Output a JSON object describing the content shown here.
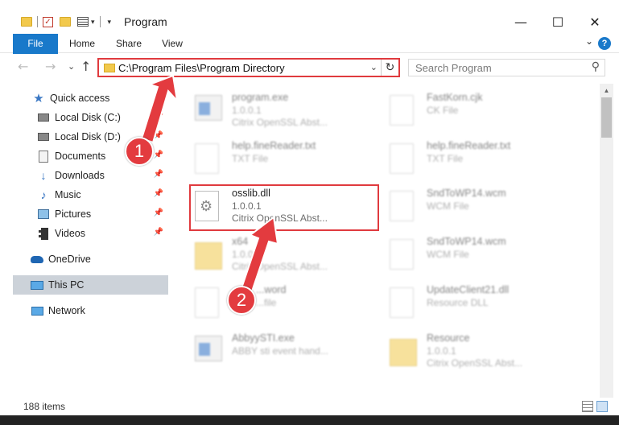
{
  "window": {
    "title": "Program",
    "minimize_icon": "minimize-icon",
    "maximize_icon": "maximize-icon",
    "close_icon": "close-icon"
  },
  "ribbon": {
    "tabs": [
      {
        "label": "File"
      },
      {
        "label": "Home"
      },
      {
        "label": "Share"
      },
      {
        "label": "View"
      }
    ],
    "help": "?",
    "expand": "⌄"
  },
  "nav": {
    "back": "←",
    "forward": "→",
    "recent": "⌄",
    "up": "↑",
    "address": "C:\\Program Files\\Program Directory",
    "search_placeholder": "Search Program"
  },
  "sidebar": {
    "items": [
      {
        "label": "Quick access",
        "icon": "star-icon"
      },
      {
        "label": "Local Disk (C:)",
        "icon": "disk-icon",
        "pinned": true
      },
      {
        "label": "Local Disk (D:)",
        "icon": "disk-icon",
        "pinned": true
      },
      {
        "label": "Documents",
        "icon": "documents-icon",
        "pinned": true
      },
      {
        "label": "Downloads",
        "icon": "downloads-icon",
        "pinned": true
      },
      {
        "label": "Music",
        "icon": "music-icon",
        "pinned": true
      },
      {
        "label": "Pictures",
        "icon": "pictures-icon",
        "pinned": true
      },
      {
        "label": "Videos",
        "icon": "videos-icon",
        "pinned": true
      },
      {
        "label": "OneDrive",
        "icon": "onedrive-icon"
      },
      {
        "label": "This PC",
        "icon": "pc-icon",
        "selected": true
      },
      {
        "label": "Network",
        "icon": "network-icon"
      }
    ]
  },
  "files": [
    {
      "name": "program.exe",
      "line1": "1.0.0.1",
      "line2": "Citrix OpenSSL Abst...",
      "icon": "exe-icon"
    },
    {
      "name": "FastKorn.cjk",
      "line1": "CK File",
      "line2": "",
      "icon": "document-icon"
    },
    {
      "name": "help.fineReader.txt",
      "line1": "TXT File",
      "line2": "",
      "icon": "document-icon"
    },
    {
      "name": "help.fineReader.txt",
      "line1": "TXT File",
      "line2": "",
      "icon": "document-icon"
    },
    {
      "name": "osslib.dll",
      "line1": "1.0.0.1",
      "line2": "Citrix OpenSSL Abst...",
      "icon": "dll-gear-icon"
    },
    {
      "name": "SndToWP14.wcm",
      "line1": "WCM File",
      "line2": "",
      "icon": "document-icon"
    },
    {
      "name": "x64",
      "line1": "1.0.0.1",
      "line2": "Citrix OpenSSL Abst...",
      "icon": "folder-icon"
    },
    {
      "name": "SndToWP14.wcm",
      "line1": "WCM File",
      "line2": "",
      "icon": "document-icon"
    },
    {
      "name": "...word",
      "line1": "...file",
      "line2": "",
      "icon": "document-icon"
    },
    {
      "name": "UpdateClient21.dll",
      "line1": "Resource DLL",
      "line2": "",
      "icon": "document-icon"
    },
    {
      "name": "AbbyySTI.exe",
      "line1": "ABBY sti event hand...",
      "line2": "",
      "icon": "exe-icon"
    },
    {
      "name": "Resource",
      "line1": "1.0.0.1",
      "line2": "Citrix OpenSSL Abst...",
      "icon": "folder-icon"
    }
  ],
  "annotations": {
    "step1": "1",
    "step2": "2",
    "color": "#e03a3e"
  },
  "status": {
    "count": "188 items"
  },
  "colors": {
    "accent": "#1979ca",
    "highlight": "#e03a3e",
    "selected_bg": "#ccd2d9"
  }
}
